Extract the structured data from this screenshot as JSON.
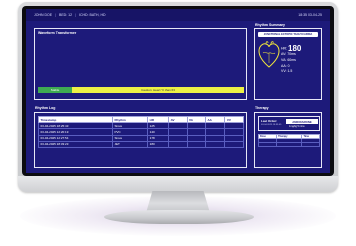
{
  "topbar": {
    "patient": "JOHN DOE",
    "bed": "BED: 12",
    "location": "ICHD: BATH, HD",
    "time": "18:35 03-04-25"
  },
  "waveform": {
    "title": "Waveform Transformer",
    "status_label": "Stable",
    "status_text": "Caution: Heart Yt than 63"
  },
  "summary": {
    "title": "Rhythm Summary",
    "rhythm": "JUNCTIONAL ECTOPIC TACHYCARDIA",
    "hr_label": "HR:",
    "hr_value": "180",
    "av": "AV: 70ms",
    "va": "VA: 60ms",
    "aa": "AA: 0",
    "vv": "VV: 1.5"
  },
  "log": {
    "title": "Rhythm Log",
    "headers": [
      "Timestamp",
      "Rhythm",
      "HR",
      "AV",
      "VA",
      "AA",
      "VV"
    ],
    "rows": [
      [
        "03-04-2025 18:25:43",
        "Sinus",
        "125",
        "",
        "",
        "",
        ""
      ],
      [
        "03-04-2025 12:20:19",
        "PVC",
        "140",
        "",
        "",
        "",
        ""
      ],
      [
        "03-04-2025 12:27:54",
        "Sinus",
        "178",
        "",
        "",
        "",
        ""
      ],
      [
        "03-04-2025 18:33:23",
        "JET",
        "180",
        "",
        "",
        "",
        ""
      ]
    ],
    "row_extra": [
      [
        "",
        "",
        "",
        "",
        "",
        "",
        ""
      ]
    ]
  },
  "therapy": {
    "title": "Therapy",
    "last_order_label": "Last Order:",
    "last_order_time": "03-04-2025 18:33:45",
    "drug": "AMIODARONE",
    "dose": "1mg/kg 5 mins",
    "headers": [
      "Dose",
      "Therapy",
      "Time"
    ],
    "rows": [
      [
        "",
        "",
        ""
      ],
      [
        "",
        "",
        ""
      ]
    ]
  },
  "colors": {
    "screen": "#1d1a7a",
    "stable": "#3eaa52",
    "caution": "#ecf045",
    "heart": "#f2e63a"
  }
}
